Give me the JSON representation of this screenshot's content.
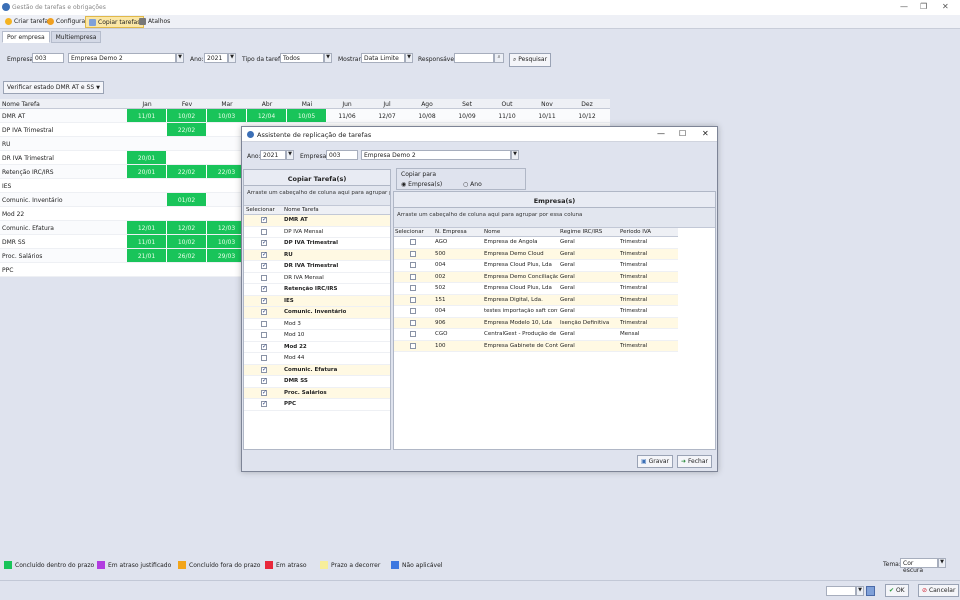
{
  "window": {
    "title": "Gestão de tarefas e obrigações"
  },
  "toolbar": {
    "create": "Criar tarefa",
    "configure": "Configurar",
    "copy": "Copiar tarefas",
    "shortcuts": "Atalhos"
  },
  "tabs": [
    "Por empresa",
    "Multiempresa"
  ],
  "filters": {
    "empresa_label": "Empresa:",
    "empresa_code": "003",
    "empresa_name": "Empresa Demo 2",
    "ano_label": "Ano:",
    "ano": "2021",
    "tipo_label": "Tipo da tarefa:",
    "tipo": "Todos",
    "mostrar_label": "Mostrar:",
    "mostrar": "Data Limite",
    "responsavel_label": "Responsável:",
    "responsavel": "",
    "pesquisar": "Pesquisar",
    "verificar": "Verificar estado DMR AT e SS"
  },
  "grid": {
    "name_header": "Nome Tarefa",
    "months": [
      "Jan",
      "Fev",
      "Mar",
      "Abr",
      "Mai",
      "Jun",
      "Jul",
      "Ago",
      "Set",
      "Out",
      "Nov",
      "Dez"
    ],
    "rows": [
      {
        "name": "DMR AT",
        "cells": [
          {
            "m": 0,
            "v": "11/01",
            "g": true
          },
          {
            "m": 1,
            "v": "10/02",
            "g": true
          },
          {
            "m": 2,
            "v": "10/03",
            "g": true
          },
          {
            "m": 3,
            "v": "12/04",
            "g": true
          },
          {
            "m": 4,
            "v": "10/05",
            "g": true
          },
          {
            "m": 5,
            "v": "11/06",
            "g": false
          },
          {
            "m": 6,
            "v": "12/07",
            "g": false
          },
          {
            "m": 7,
            "v": "10/08",
            "g": false
          },
          {
            "m": 8,
            "v": "10/09",
            "g": false
          },
          {
            "m": 9,
            "v": "11/10",
            "g": false
          },
          {
            "m": 10,
            "v": "10/11",
            "g": false
          },
          {
            "m": 11,
            "v": "10/12",
            "g": false
          }
        ]
      },
      {
        "name": "DP IVA Trimestral",
        "cells": [
          {
            "m": 1,
            "v": "22/02",
            "g": true
          }
        ]
      },
      {
        "name": "RU",
        "cells": []
      },
      {
        "name": "DR IVA Trimestral",
        "cells": [
          {
            "m": 0,
            "v": "20/01",
            "g": true
          }
        ]
      },
      {
        "name": "Retenção IRC/IRS",
        "cells": [
          {
            "m": 0,
            "v": "20/01",
            "g": true
          },
          {
            "m": 1,
            "v": "22/02",
            "g": true
          },
          {
            "m": 2,
            "v": "22/03",
            "g": true
          }
        ]
      },
      {
        "name": "IES",
        "cells": []
      },
      {
        "name": "Comunic. Inventário",
        "cells": [
          {
            "m": 1,
            "v": "01/02",
            "g": true
          }
        ]
      },
      {
        "name": "Mod 22",
        "cells": []
      },
      {
        "name": "Comunic. Efatura",
        "cells": [
          {
            "m": 0,
            "v": "12/01",
            "g": true
          },
          {
            "m": 1,
            "v": "12/02",
            "g": true
          },
          {
            "m": 2,
            "v": "12/03",
            "g": true
          }
        ]
      },
      {
        "name": "DMR SS",
        "cells": [
          {
            "m": 0,
            "v": "11/01",
            "g": true
          },
          {
            "m": 1,
            "v": "10/02",
            "g": true
          },
          {
            "m": 2,
            "v": "10/03",
            "g": true
          }
        ]
      },
      {
        "name": "Proc. Salários",
        "cells": [
          {
            "m": 0,
            "v": "21/01",
            "g": true
          },
          {
            "m": 1,
            "v": "26/02",
            "g": true
          },
          {
            "m": 2,
            "v": "29/03",
            "g": true
          }
        ]
      },
      {
        "name": "PPC",
        "cells": []
      }
    ]
  },
  "dialog": {
    "title": "Assistente de replicação de tarefas",
    "ano_label": "Ano:",
    "ano": "2021",
    "empresa_label": "Empresa:",
    "empresa_code": "003",
    "empresa_name": "Empresa Demo 2",
    "copy_tasks_header": "Copiar Tarefa(s)",
    "group_hint": "Arraste um cabeçalho de coluna aqui para agrupar por essa coluna",
    "group_hint_left": "Arraste um cabeçalho de coluna aqui para agrupar por essa",
    "copiar_para": "Copiar para",
    "opt_empresas": "Empresa(s)",
    "opt_ano": "Ano",
    "empresas_header": "Empresa(s)",
    "tasks_cols": [
      "Selecionar",
      "Nome Tarefa"
    ],
    "tasks": [
      {
        "name": "DMR AT",
        "checked": true,
        "bold": true,
        "yellow": true
      },
      {
        "name": "DP IVA Mensal",
        "checked": false,
        "bold": false,
        "yellow": false
      },
      {
        "name": "DP IVA Trimestral",
        "checked": true,
        "bold": true,
        "yellow": false
      },
      {
        "name": "RU",
        "checked": true,
        "bold": true,
        "yellow": true
      },
      {
        "name": "DR IVA Trimestral",
        "checked": true,
        "bold": true,
        "yellow": false
      },
      {
        "name": "DR IVA Mensal",
        "checked": false,
        "bold": false,
        "yellow": false
      },
      {
        "name": "Retenção IRC/IRS",
        "checked": true,
        "bold": true,
        "yellow": false
      },
      {
        "name": "IES",
        "checked": true,
        "bold": true,
        "yellow": true
      },
      {
        "name": "Comunic. Inventário",
        "checked": true,
        "bold": true,
        "yellow": true
      },
      {
        "name": "Mod 3",
        "checked": false,
        "bold": false,
        "yellow": false
      },
      {
        "name": "Mod 10",
        "checked": false,
        "bold": false,
        "yellow": false
      },
      {
        "name": "Mod 22",
        "checked": true,
        "bold": true,
        "yellow": false
      },
      {
        "name": "Mod 44",
        "checked": false,
        "bold": false,
        "yellow": false
      },
      {
        "name": "Comunic. Efatura",
        "checked": true,
        "bold": true,
        "yellow": true
      },
      {
        "name": "DMR SS",
        "checked": true,
        "bold": true,
        "yellow": false
      },
      {
        "name": "Proc. Salários",
        "checked": true,
        "bold": true,
        "yellow": true
      },
      {
        "name": "PPC",
        "checked": true,
        "bold": true,
        "yellow": false
      }
    ],
    "emp_cols": [
      "Selecionar",
      "N. Empresa",
      "Nome",
      "Regime IRC/IRS",
      "Período IVA"
    ],
    "empresas": [
      {
        "num": "AGO",
        "nome": "Empresa de Angola",
        "regime": "Geral",
        "periodo": "Trimestral",
        "yellow": false
      },
      {
        "num": "500",
        "nome": "Empresa Demo Cloud",
        "regime": "Geral",
        "periodo": "Trimestral",
        "yellow": true
      },
      {
        "num": "004",
        "nome": "Empresa Cloud Plus, Lda",
        "regime": "Geral",
        "periodo": "Trimestral",
        "yellow": false
      },
      {
        "num": "002",
        "nome": "Empresa Demo Conciliação",
        "regime": "Geral",
        "periodo": "Trimestral",
        "yellow": true
      },
      {
        "num": "502",
        "nome": "Empresa Cloud Plus, Lda",
        "regime": "Geral",
        "periodo": "Trimestral",
        "yellow": false
      },
      {
        "num": "151",
        "nome": "Empresa Digital, Lda.",
        "regime": "Geral",
        "periodo": "Trimestral",
        "yellow": true
      },
      {
        "num": "004",
        "nome": "testes importação saft contabi",
        "regime": "Geral",
        "periodo": "Trimestral",
        "yellow": false
      },
      {
        "num": "906",
        "nome": "Empresa Modelo 10, Lda",
        "regime": "Isenção Definitiva",
        "periodo": "Trimestral",
        "yellow": true
      },
      {
        "num": "CGO",
        "nome": "CentralGest - Produção de Sof",
        "regime": "Geral",
        "periodo": "Mensal",
        "yellow": false
      },
      {
        "num": "100",
        "nome": "Empresa Gabinete de Contabili",
        "regime": "Geral",
        "periodo": "Trimestral",
        "yellow": true
      }
    ],
    "gravar": "Gravar",
    "fechar": "Fechar"
  },
  "legend": [
    {
      "label": "Concluído dentro do prazo",
      "color": "#19c45a"
    },
    {
      "label": "Em atraso justificado",
      "color": "#b23de0"
    },
    {
      "label": "Concluído fora do prazo",
      "color": "#f2a51a"
    },
    {
      "label": "Em atraso",
      "color": "#e8283b"
    },
    {
      "label": "Prazo a decorrer",
      "color": "#f7ee9a"
    },
    {
      "label": "Não aplicável",
      "color": "#3d78e0"
    }
  ],
  "tema": {
    "label": "Tema:",
    "value": "Cor escura"
  },
  "footer": {
    "ok": "OK",
    "cancel": "Cancelar"
  }
}
